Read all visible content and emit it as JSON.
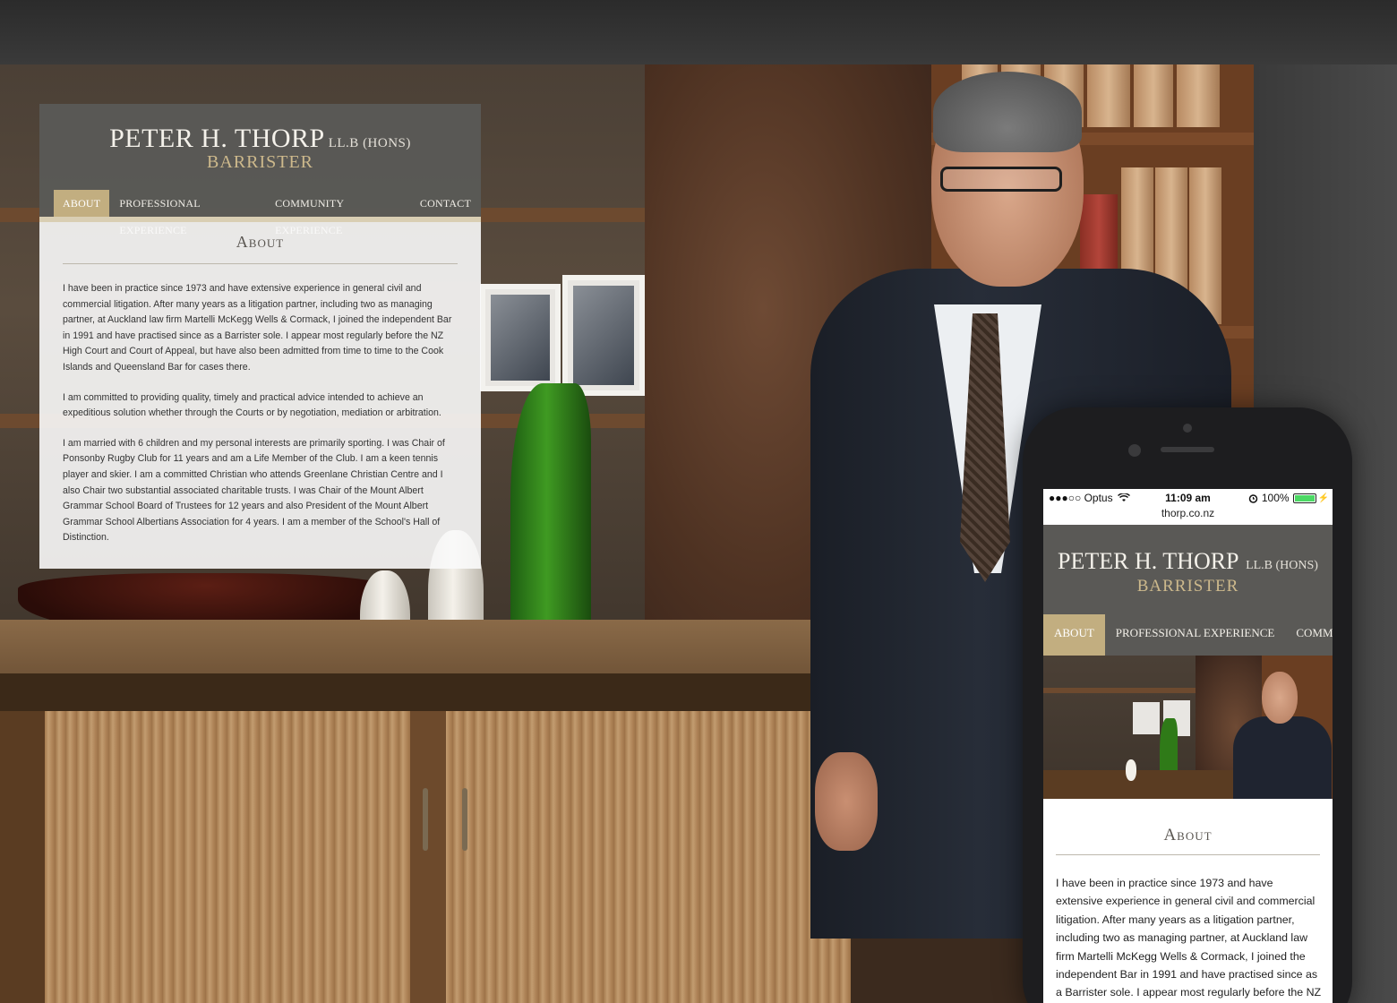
{
  "desktop": {
    "name": "PETER H. THORP",
    "quals": "LL.B (HONS)",
    "role": "BARRISTER",
    "nav": [
      {
        "label": "ABOUT"
      },
      {
        "label": "PROFESSIONAL EXPERIENCE"
      },
      {
        "label": "COMMUNITY EXPERIENCE"
      },
      {
        "label": "CONTACT"
      }
    ],
    "heading": "About",
    "paragraphs": [
      "I have been in practice since 1973 and have extensive experience in general civil and commercial litigation. After many years as a litigation partner, including two as managing partner, at Auckland law firm Martelli McKegg Wells & Cormack, I joined the independent Bar in 1991 and have practised since as a Barrister sole. I appear most regularly before the NZ High Court and Court of Appeal, but have also been admitted from time to time to the Cook Islands and Queensland Bar for cases there.",
      "I am committed to providing quality, timely and practical advice intended to achieve an expeditious solution whether through the Courts or by negotiation, mediation or arbitration.",
      "I am married with 6 children and my personal interests are primarily sporting. I was Chair of Ponsonby Rugby Club for 11 years and am a Life Member of the Club. I am a keen tennis player and skier. I am a committed Christian who attends Greenlane Christian Centre and I also Chair two substantial associated charitable trusts. I was Chair of the Mount Albert Grammar School Board of Trustees for 12 years and also President of the Mount Albert Grammar School Albertians Association for 4 years. I am a member of the School's Hall of Distinction."
    ]
  },
  "phone": {
    "status": {
      "carrier": "●●●○○ Optus",
      "time": "11:09 am",
      "battery": "100%",
      "battery_level": 1.0
    },
    "url": "thorp.co.nz",
    "name": "PETER H. THORP",
    "quals": "LL.B (HONS)",
    "role": "BARRISTER",
    "nav": [
      {
        "label": "ABOUT"
      },
      {
        "label": "PROFESSIONAL EXPERIENCE"
      },
      {
        "label": "COMMU"
      }
    ],
    "heading": "About",
    "paragraph": "I have been in practice since 1973 and have extensive experience in general civil and commercial litigation. After many years as a litigation partner, including two as managing partner, at Auckland law firm Martelli McKegg Wells & Cormack, I joined the independent Bar in 1991 and have practised since as a Barrister sole. I appear most regularly before the NZ High Court"
  },
  "colors": {
    "header_bg": "#5a5956",
    "accent_gold": "#c2ae80",
    "role_gold": "#cdb98c"
  },
  "icons": [
    "wifi-icon",
    "alarm-icon",
    "battery-icon"
  ]
}
